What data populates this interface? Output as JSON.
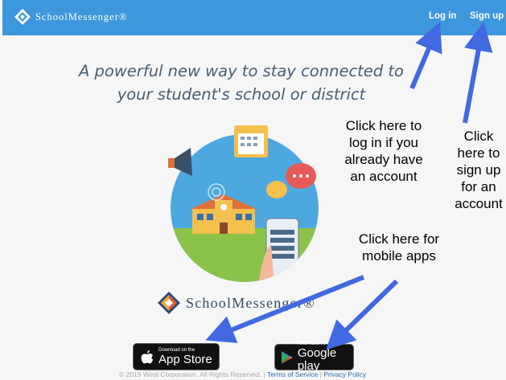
{
  "header": {
    "brand": "SchoolMessenger®",
    "login_label": "Log in",
    "signup_label": "Sign up"
  },
  "headline": {
    "line1": "A powerful new way to stay connected to",
    "line2": "your student's school or district"
  },
  "annotations": {
    "login_note": [
      "Click here to",
      "log in if you",
      "already have",
      "an account"
    ],
    "signup_note": [
      "Click",
      "here to",
      "sign up",
      "for an",
      "account"
    ],
    "apps_note": [
      "Click here for",
      "mobile apps"
    ]
  },
  "footer_brand": "SchoolMessenger®",
  "app_store": {
    "small": "Download on the",
    "big": "App Store"
  },
  "google_play": {
    "small": "ANDROID APP ON",
    "big": "Google play"
  },
  "copyright": {
    "text": "© 2019 West Corporation. All Rights Reserved. |",
    "terms": "Terms of Service",
    "sep": "|",
    "privacy": "Privacy Policy"
  },
  "colors": {
    "header": "#3d97dc",
    "arrow": "#4169e1"
  }
}
